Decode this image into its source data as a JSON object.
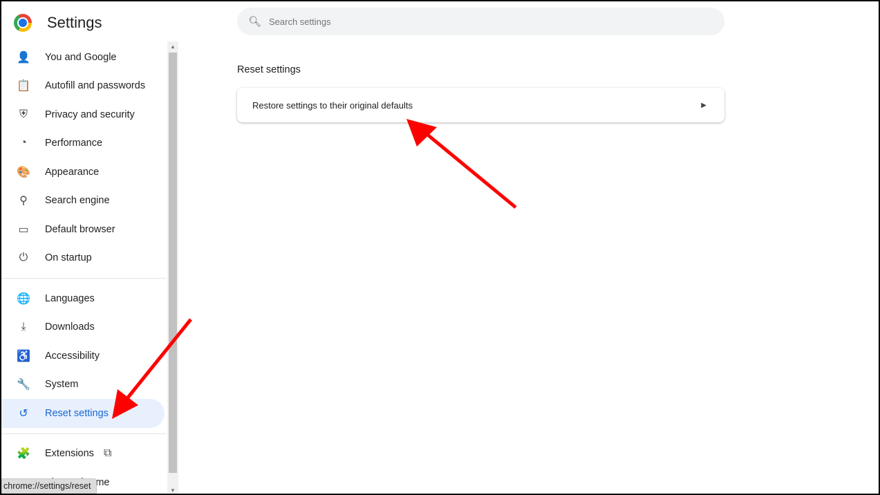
{
  "header": {
    "title": "Settings",
    "search_placeholder": "Search settings"
  },
  "sidebar": {
    "items": [
      {
        "label": "You and Google",
        "icon": "person-icon",
        "glyph": "👤"
      },
      {
        "label": "Autofill and passwords",
        "icon": "clipboard-icon",
        "glyph": "📋"
      },
      {
        "label": "Privacy and security",
        "icon": "shield-icon",
        "glyph": "⛨"
      },
      {
        "label": "Performance",
        "icon": "speedometer-icon",
        "glyph": "◔"
      },
      {
        "label": "Appearance",
        "icon": "palette-icon",
        "glyph": "🎨"
      },
      {
        "label": "Search engine",
        "icon": "search-icon",
        "glyph": "⚲"
      },
      {
        "label": "Default browser",
        "icon": "browser-icon",
        "glyph": "▭"
      },
      {
        "label": "On startup",
        "icon": "power-icon",
        "glyph": "⏻"
      },
      {
        "label": "Languages",
        "icon": "globe-icon",
        "glyph": "🌐"
      },
      {
        "label": "Downloads",
        "icon": "download-icon",
        "glyph": "⤓"
      },
      {
        "label": "Accessibility",
        "icon": "accessibility-icon",
        "glyph": "♿"
      },
      {
        "label": "System",
        "icon": "wrench-icon",
        "glyph": "🔧"
      },
      {
        "label": "Reset settings",
        "icon": "history-icon",
        "glyph": "↺",
        "active": true
      },
      {
        "label": "Extensions",
        "icon": "puzzle-icon",
        "glyph": "🧩",
        "external": "open-in-new-icon"
      },
      {
        "label": "About Chrome",
        "icon": "chrome-icon",
        "glyph": "◉"
      }
    ]
  },
  "main": {
    "section_title": "Reset settings",
    "row_label": "Restore settings to their original defaults"
  },
  "status_bar": "chrome://settings/reset",
  "colors": {
    "accent": "#1967d2",
    "active_bg": "#e8f0fe",
    "annotation_arrow": "#ff0000"
  }
}
